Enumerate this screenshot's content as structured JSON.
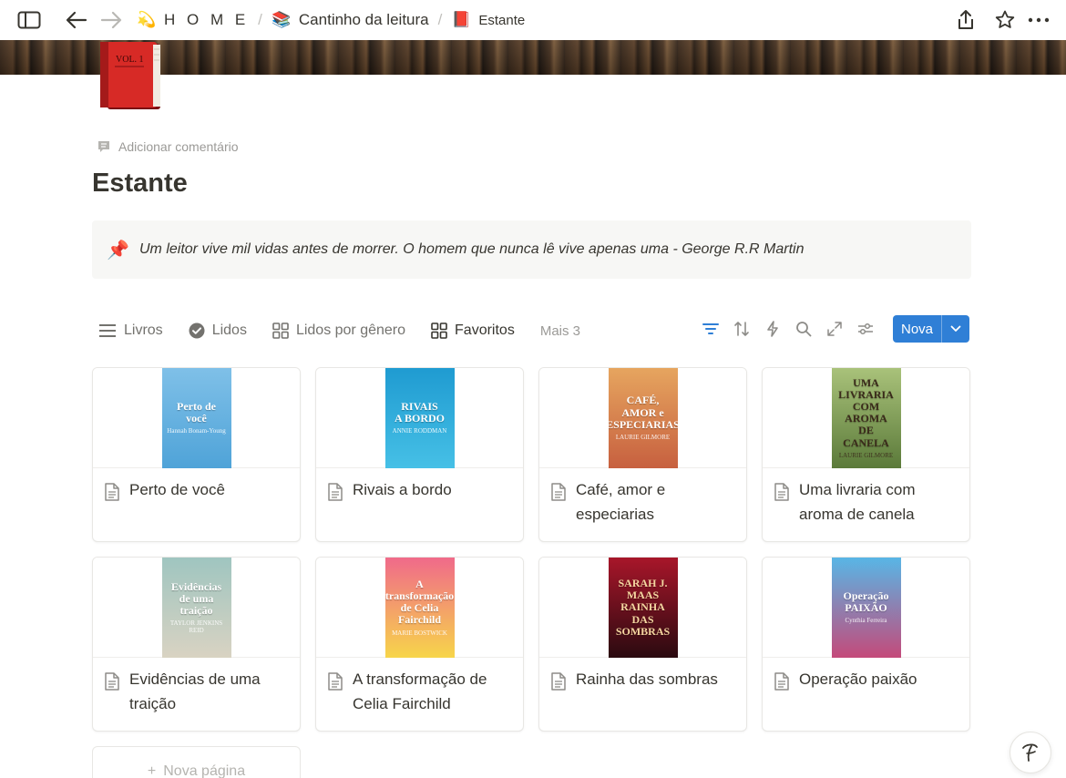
{
  "topbar": {
    "breadcrumbs": [
      {
        "emoji": "💫",
        "label": "H O M E"
      },
      {
        "emoji": "📚",
        "label": "Cantinho da leitura"
      },
      {
        "emoji": "📕",
        "label": "Estante"
      }
    ],
    "separator": "/"
  },
  "page": {
    "add_comment_label": "Adicionar comentário",
    "title": "Estante",
    "callout": {
      "icon": "📌",
      "text": "Um leitor vive mil vidas antes de morrer. O homem que nunca lê vive apenas uma - George R.R Martin"
    }
  },
  "views": {
    "tabs": [
      {
        "label": "Livros",
        "icon": "list-icon"
      },
      {
        "label": "Lidos",
        "icon": "check-circle-icon"
      },
      {
        "label": "Lidos por gênero",
        "icon": "board-icon"
      },
      {
        "label": "Favoritos",
        "icon": "gallery-icon",
        "active": true
      }
    ],
    "more_label": "Mais 3",
    "new_button_label": "Nova"
  },
  "gallery": {
    "cards": [
      {
        "title": "Perto de você",
        "cover": {
          "lines": [
            "Perto de você"
          ],
          "author": "Hannah Bonam-Young",
          "bg": "#7fc0e8",
          "bg2": "#4fa3d8",
          "text": "#ffffff"
        }
      },
      {
        "title": "Rivais a bordo",
        "cover": {
          "lines": [
            "RIVAIS",
            "A BORDO"
          ],
          "author": "ANNIE RODDMAN",
          "bg": "#1f9bd1",
          "bg2": "#46c0e6",
          "text": "#ffffff"
        }
      },
      {
        "title": "Café, amor e especiarias",
        "cover": {
          "lines": [
            "CAFÉ,",
            "AMOR e",
            "ESPECIARIAS"
          ],
          "author": "LAURIE GILMORE",
          "bg": "#e6a55f",
          "bg2": "#c7603f",
          "text": "#ffffff"
        }
      },
      {
        "title": "Uma livraria com aroma de canela",
        "cover": {
          "lines": [
            "UMA",
            "LIVRARIA",
            "COM AROMA",
            "DE CANELA"
          ],
          "author": "LAURIE GILMORE",
          "bg": "#a9c27a",
          "bg2": "#5b7a3a",
          "text": "#3a2a1a"
        }
      },
      {
        "title": "Evidências de uma traição",
        "cover": {
          "lines": [
            "Evidências",
            "de uma traição"
          ],
          "author": "TAYLOR JENKINS REID",
          "bg": "#9fc5c0",
          "bg2": "#d9d3c2",
          "text": "#ffffff"
        }
      },
      {
        "title": "A transformação de Celia Fairchild",
        "cover": {
          "lines": [
            "A transformação",
            "de Celia Fairchild"
          ],
          "author": "MARIE BOSTWICK",
          "bg": "#f06a8a",
          "bg2": "#f7d54a",
          "text": "#ffffff"
        }
      },
      {
        "title": "Rainha das sombras",
        "cover": {
          "lines": [
            "SARAH J.",
            "MAAS",
            "RAINHA",
            "DAS",
            "SOMBRAS"
          ],
          "author": "",
          "bg": "#a8162a",
          "bg2": "#2a0a10",
          "text": "#f5d6a0"
        }
      },
      {
        "title": "Operação paixão",
        "cover": {
          "lines": [
            "Operação",
            "PAIXÃO"
          ],
          "author": "Cynthia Ferreira",
          "bg": "#58b6e6",
          "bg2": "#c44a7a",
          "text": "#ffffff"
        }
      }
    ],
    "new_page_label": "Nova página"
  },
  "help_button_label": "?"
}
